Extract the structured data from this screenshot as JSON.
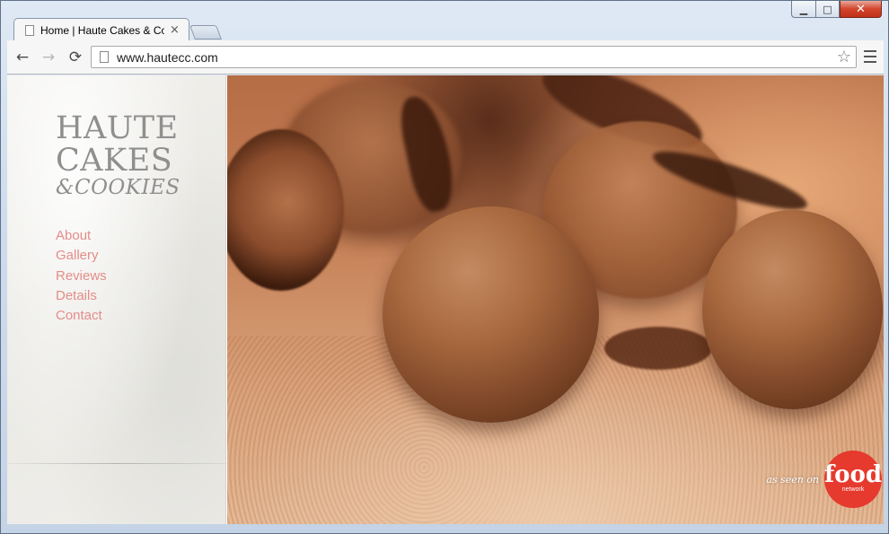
{
  "browser": {
    "tab_title": "Home | Haute Cakes & Co",
    "tab_close": "×",
    "url": "www.hautecc.com",
    "window_controls": {
      "minimize": "▁",
      "maximize": "□",
      "close": "✕"
    },
    "nav": {
      "back": "←",
      "forward": "→",
      "reload": "⟳",
      "bookmark_star": "☆"
    }
  },
  "site": {
    "logo": {
      "line1": "HAUTE",
      "line2": "CAKES",
      "line3": "&COOKIES"
    },
    "nav": [
      {
        "label": "About"
      },
      {
        "label": "Gallery"
      },
      {
        "label": "Reviews"
      },
      {
        "label": "Details"
      },
      {
        "label": "Contact"
      }
    ],
    "badge": {
      "as_seen_on": "as seen on",
      "brand": "food",
      "brand_sub": "network"
    },
    "colors": {
      "nav_link": "#e48d88",
      "logo": "#8f8f8f",
      "badge": "#e63a2e"
    }
  }
}
